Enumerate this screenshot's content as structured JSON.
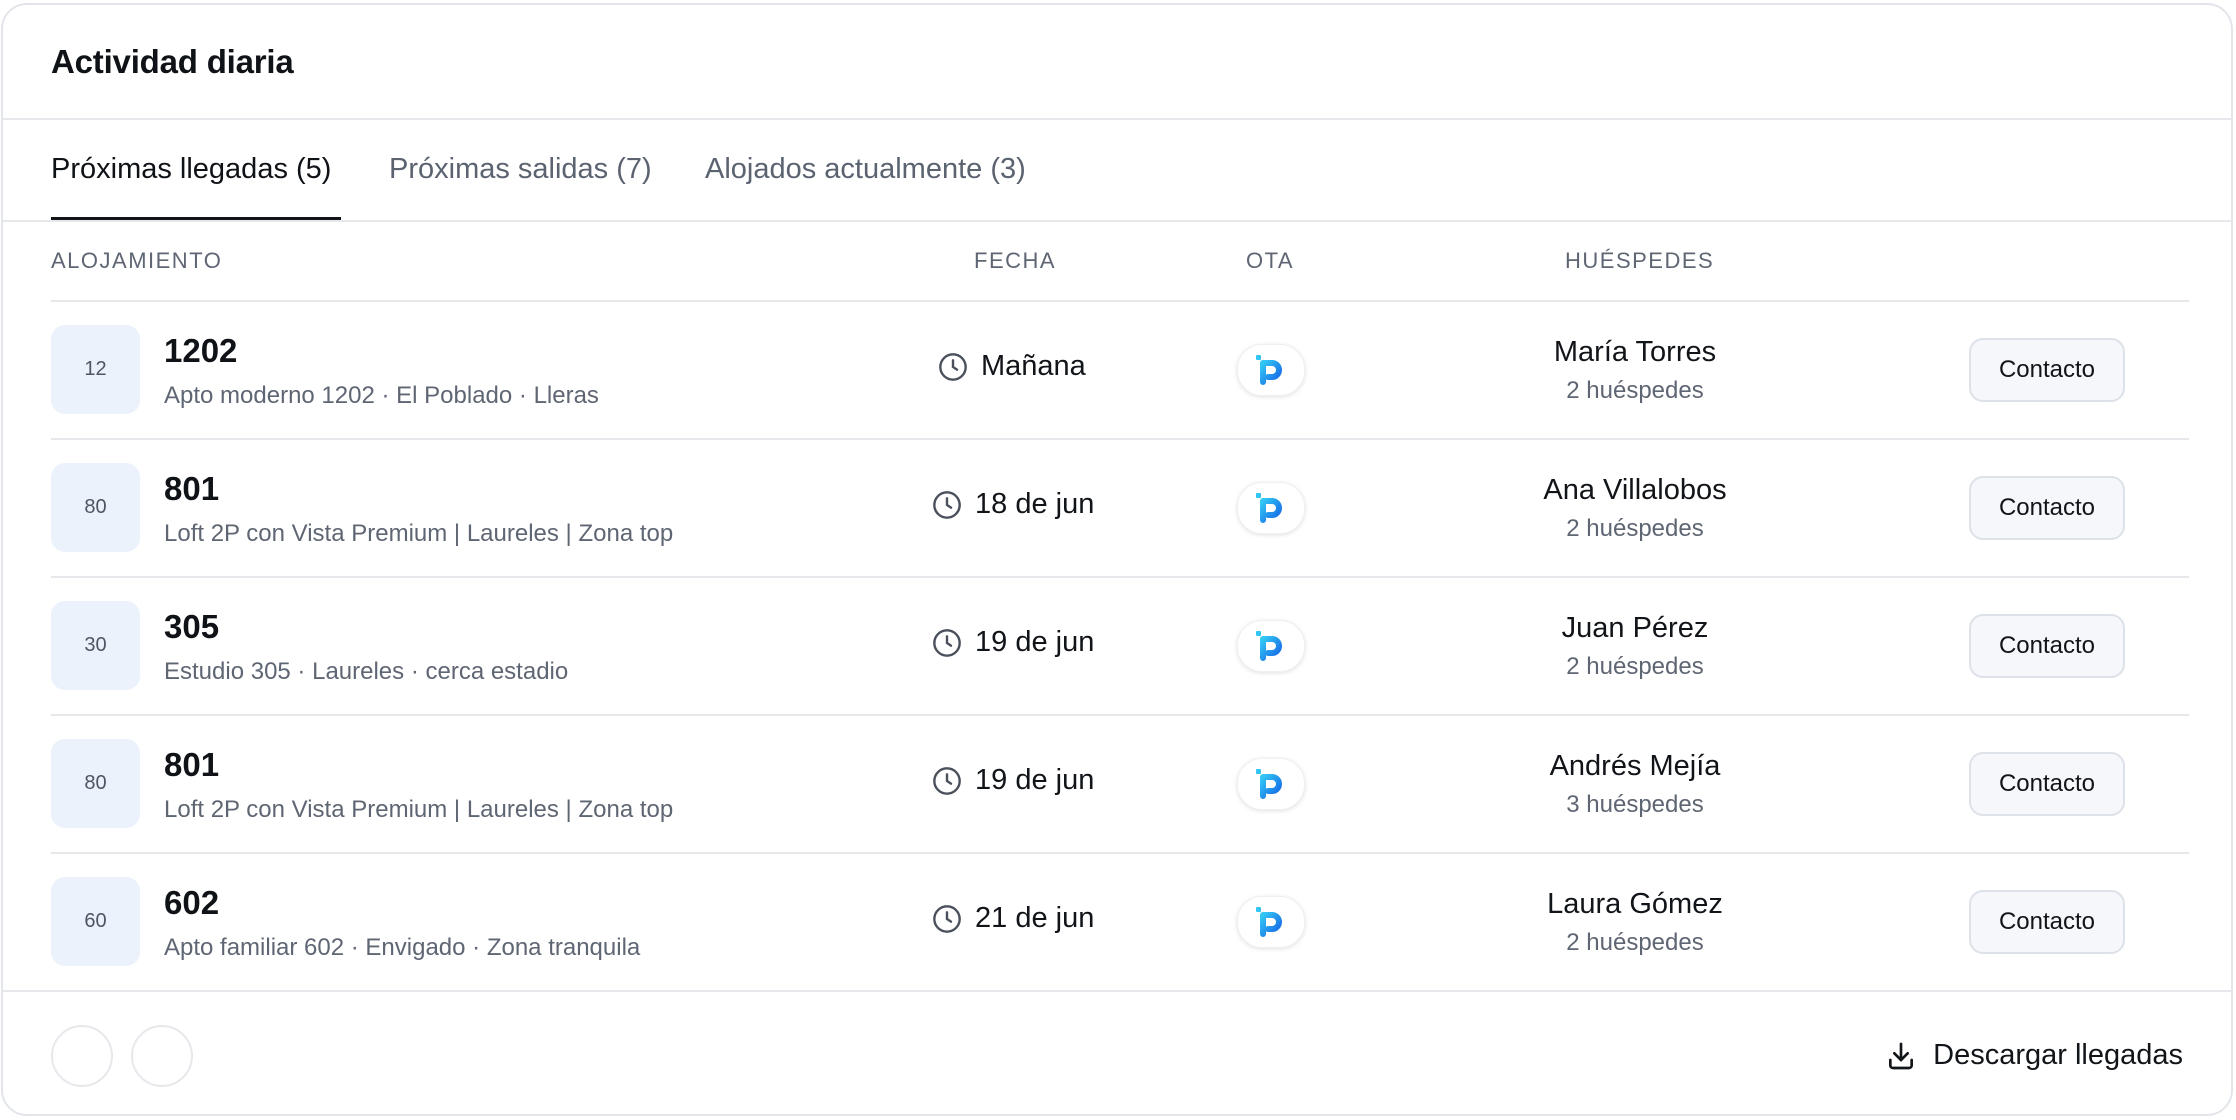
{
  "title": "Actividad diaria",
  "tabs": [
    {
      "label": "Próximas llegadas (5)",
      "active": true
    },
    {
      "label": "Próximas salidas (7)",
      "active": false
    },
    {
      "label": "Alojados actualmente (3)",
      "active": false
    }
  ],
  "columns": {
    "alojamiento": "ALOJAMIENTO",
    "fecha": "FECHA",
    "ota": "OTA",
    "huespedes": "HUÉSPEDES"
  },
  "rows": [
    {
      "thumb": "12",
      "unit": "1202",
      "desc": "Apto moderno 1202 · El Poblado · Lleras",
      "date": "Mañana",
      "ota_icon": "p-logo-icon",
      "guest": "María Torres",
      "guests": "2 huéspedes",
      "action": "Contacto"
    },
    {
      "thumb": "80",
      "unit": "801",
      "desc": "Loft 2P con Vista Premium | Laureles | Zona top",
      "date": "18 de jun",
      "ota_icon": "p-logo-icon",
      "guest": "Ana Villalobos",
      "guests": "2 huéspedes",
      "action": "Contacto"
    },
    {
      "thumb": "30",
      "unit": "305",
      "desc": "Estudio 305 · Laureles · cerca estadio",
      "date": "19 de jun",
      "ota_icon": "p-logo-icon",
      "guest": "Juan Pérez",
      "guests": "2 huéspedes",
      "action": "Contacto"
    },
    {
      "thumb": "80",
      "unit": "801",
      "desc": "Loft 2P con Vista Premium | Laureles | Zona top",
      "date": "19 de jun",
      "ota_icon": "p-logo-icon",
      "guest": "Andrés Mejía",
      "guests": "3 huéspedes",
      "action": "Contacto"
    },
    {
      "thumb": "60",
      "unit": "602",
      "desc": "Apto familiar 602 · Envigado · Zona tranquila",
      "date": "21 de jun",
      "ota_icon": "p-logo-icon",
      "guest": "Laura Gómez",
      "guests": "2 huéspedes",
      "action": "Contacto"
    }
  ],
  "footer": {
    "download_label": "Descargar llegadas",
    "download_icon": "download-icon"
  },
  "colors": {
    "accent": "#111418",
    "ota_gradient_start": "#33c6f4",
    "ota_gradient_end": "#1466e6",
    "thumb_bg": "#ebf2fb"
  }
}
